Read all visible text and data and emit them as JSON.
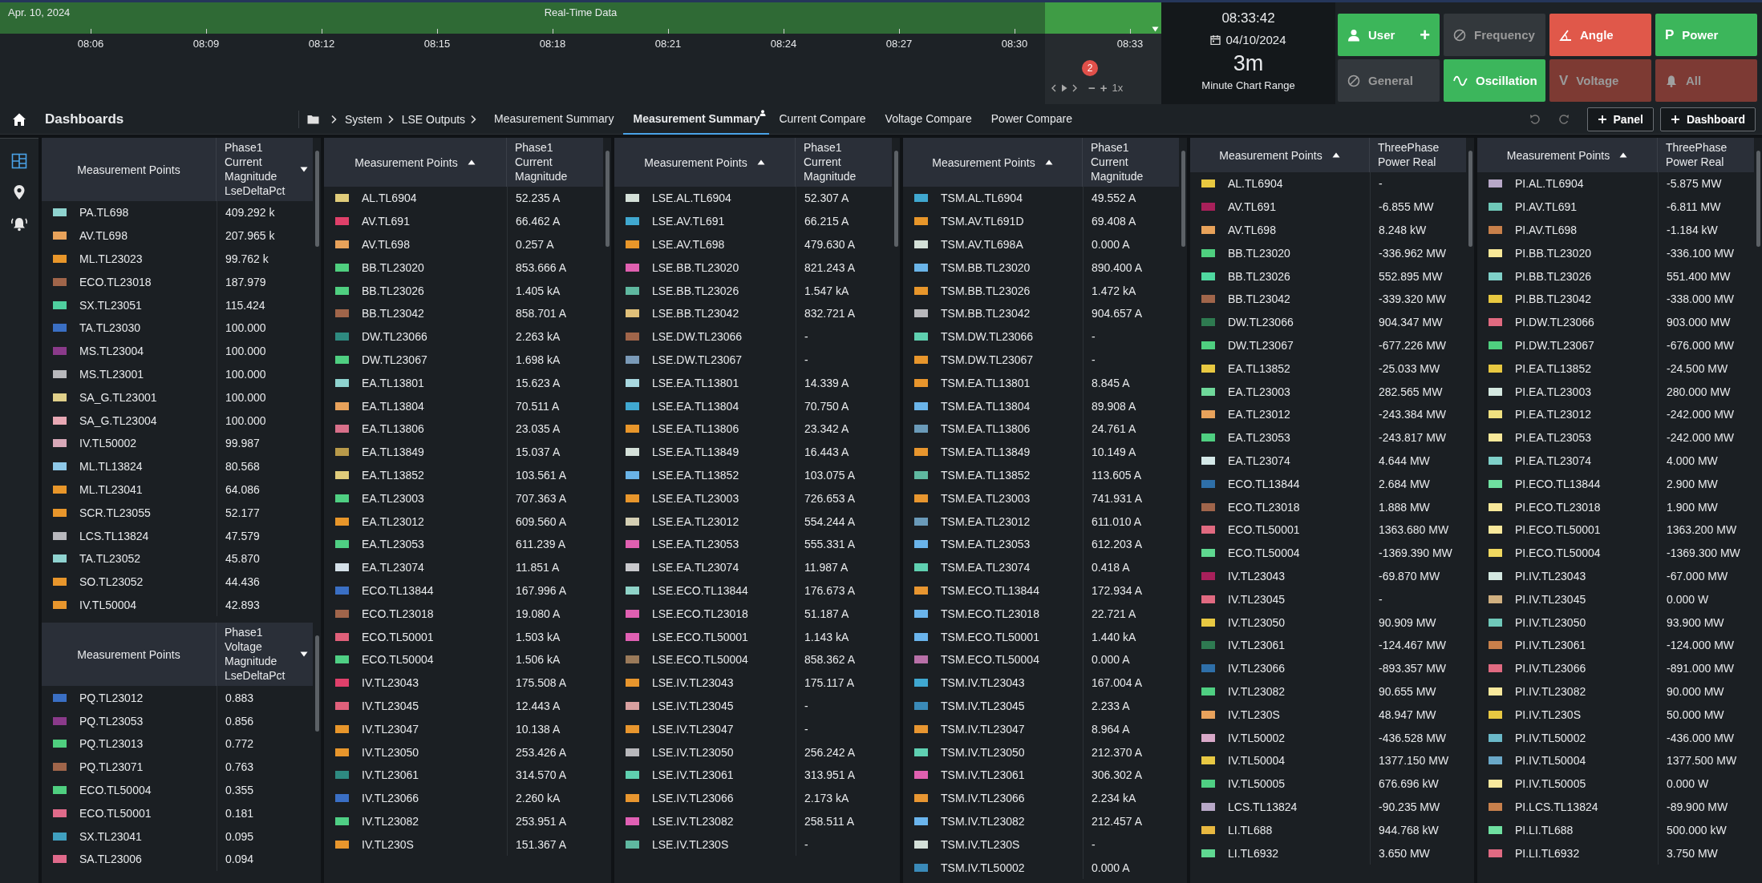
{
  "timeline": {
    "date": "Apr. 10, 2024",
    "title": "Real-Time Data",
    "ticks": [
      "08:06",
      "08:09",
      "08:12",
      "08:15",
      "08:18",
      "08:21",
      "08:24",
      "08:27",
      "08:30",
      "08:33"
    ],
    "alert_count": "2",
    "zoom_out": "−",
    "zoom_in": "+",
    "zoom_level": "1x"
  },
  "clock": {
    "time": "08:33:42",
    "date": "04/10/2024",
    "range": "3m",
    "range_label": "Minute Chart Range"
  },
  "modes": [
    {
      "label": "User",
      "suffix": "+",
      "color": "#3cb65a",
      "on": true
    },
    {
      "label": "Frequency",
      "color": "#33383c",
      "on": false
    },
    {
      "label": "Angle",
      "color": "#e0584a",
      "on": true
    },
    {
      "label": "Power",
      "glyph": "P",
      "color": "#3cb65b",
      "on": true
    },
    {
      "label": "General",
      "color": "#33383d",
      "on": false
    },
    {
      "label": "Oscillation",
      "color": "#3cb65c",
      "on": true
    },
    {
      "label": "Voltage",
      "glyph": "V",
      "color": "#7d3a33",
      "on": false
    },
    {
      "label": "All",
      "color": "#7d3a34",
      "on": false
    }
  ],
  "toolbar": {
    "title": "Dashboards",
    "breadcrumb": [
      "System",
      "LSE Outputs"
    ],
    "tabs": [
      {
        "label": "Measurement Summary",
        "selected": false,
        "shared": false
      },
      {
        "label": "Measurement Summary",
        "selected": true,
        "shared": true
      },
      {
        "label": "Current Compare",
        "selected": false,
        "shared": false
      },
      {
        "label": "Voltage Compare",
        "selected": false,
        "shared": false
      },
      {
        "label": "Power Compare",
        "selected": false,
        "shared": false
      }
    ],
    "actions": [
      "Panel",
      "Dashboard"
    ]
  },
  "sidebar": {
    "items": [
      {
        "selected": true
      },
      {
        "selected": false
      },
      {
        "selected": false
      }
    ]
  },
  "panels": [
    {
      "tables": [
        {
          "columns": [
            {
              "label": "Measurement Points",
              "sort_ascending": false,
              "menu": false
            },
            {
              "label": "Phase1 Current Magnitude LseDeltaPct",
              "sort_ascending": false,
              "menu": true
            }
          ],
          "rows": [
            {
              "name": "PA.TL698",
              "value": "409.292 k",
              "color": "#8fd3cf"
            },
            {
              "name": "AV.TL698",
              "value": "207.965 k",
              "color": "#e8a25a"
            },
            {
              "name": "ML.TL23023",
              "value": "99.762 k",
              "color": "#e8962a"
            },
            {
              "name": "ECO.TL23018",
              "value": "187.979",
              "color": "#a0654a"
            },
            {
              "name": "SX.TL23051",
              "value": "115.424",
              "color": "#4fcf9f"
            },
            {
              "name": "TA.TL23030",
              "value": "100.000",
              "color": "#3a6fc4"
            },
            {
              "name": "MS.TL23004",
              "value": "100.000",
              "color": "#8a3a8a"
            },
            {
              "name": "MS.TL23001",
              "value": "100.000",
              "color": "#b8b8bc"
            },
            {
              "name": "SA_G.TL23001",
              "value": "100.000",
              "color": "#e0d08a"
            },
            {
              "name": "SA_G.TL23004",
              "value": "100.000",
              "color": "#e8a8b4"
            },
            {
              "name": "IV.TL50002",
              "value": "99.987",
              "color": "#d8a8b8"
            },
            {
              "name": "ML.TL13824",
              "value": "80.568",
              "color": "#8ec8e8"
            },
            {
              "name": "ML.TL23041",
              "value": "64.086",
              "color": "#e8962a"
            },
            {
              "name": "SCR.TL23055",
              "value": "52.177",
              "color": "#e8962b"
            },
            {
              "name": "LCS.TL13824",
              "value": "47.579",
              "color": "#b8b8bd"
            },
            {
              "name": "TA.TL23052",
              "value": "45.870",
              "color": "#8fd3d0"
            },
            {
              "name": "SO.TL23052",
              "value": "44.436",
              "color": "#e8962c"
            },
            {
              "name": "IV.TL50004",
              "value": "42.893",
              "color": "#e8962d"
            }
          ]
        },
        {
          "columns": [
            {
              "label": "Measurement Points",
              "sort_ascending": false,
              "menu": false
            },
            {
              "label": "Phase1 Voltage Magnitude LseDeltaPct",
              "sort_ascending": false,
              "menu": true
            }
          ],
          "rows": [
            {
              "name": "PQ.TL23012",
              "value": "0.883",
              "color": "#3a6fc4"
            },
            {
              "name": "PQ.TL23053",
              "value": "0.856",
              "color": "#8a3a8a"
            },
            {
              "name": "PQ.TL23013",
              "value": "0.772",
              "color": "#4fcf7f"
            },
            {
              "name": "PQ.TL23071",
              "value": "0.763",
              "color": "#a0654a"
            },
            {
              "name": "ECO.TL50004",
              "value": "0.355",
              "color": "#4fcf80"
            },
            {
              "name": "ECO.TL50001",
              "value": "0.181",
              "color": "#e06a8a"
            },
            {
              "name": "SX.TL23041",
              "value": "0.095",
              "color": "#40a0c0"
            },
            {
              "name": "SA.TL23006",
              "value": "0.094",
              "color": "#e06a8b"
            }
          ]
        }
      ]
    },
    {
      "tables": [
        {
          "columns": [
            {
              "label": "Measurement Points",
              "sort_ascending": true,
              "menu": false
            },
            {
              "label": "Phase1 Current Magnitude",
              "sort_ascending": false,
              "menu": false
            }
          ],
          "rows": [
            {
              "name": "AL.TL6904",
              "value": "52.235 A",
              "color": "#e0cc7a"
            },
            {
              "name": "AV.TL691",
              "value": "66.462 A",
              "color": "#e0406a"
            },
            {
              "name": "AV.TL698",
              "value": "0.257 A",
              "color": "#e8a25a"
            },
            {
              "name": "BB.TL23020",
              "value": "853.666 A",
              "color": "#4fcf7f"
            },
            {
              "name": "BB.TL23026",
              "value": "1.405 kA",
              "color": "#4fcf80"
            },
            {
              "name": "BB.TL23042",
              "value": "858.701 A",
              "color": "#a0654a"
            },
            {
              "name": "DW.TL23066",
              "value": "2.263 kA",
              "color": "#2e8a80"
            },
            {
              "name": "DW.TL23067",
              "value": "1.698 kA",
              "color": "#4fcf81"
            },
            {
              "name": "EA.TL13801",
              "value": "15.623 A",
              "color": "#8fd3cf"
            },
            {
              "name": "EA.TL13804",
              "value": "70.511 A",
              "color": "#e8a25b"
            },
            {
              "name": "EA.TL13806",
              "value": "23.035 A",
              "color": "#d8708a"
            },
            {
              "name": "EA.TL13849",
              "value": "15.037 A",
              "color": "#b89a4a"
            },
            {
              "name": "EA.TL13852",
              "value": "103.561 A",
              "color": "#e0cc7b"
            },
            {
              "name": "EA.TL23003",
              "value": "707.363 A",
              "color": "#4fcf82"
            },
            {
              "name": "EA.TL23012",
              "value": "609.560 A",
              "color": "#e8962a"
            },
            {
              "name": "EA.TL23053",
              "value": "611.239 A",
              "color": "#4fcf83"
            },
            {
              "name": "EA.TL23074",
              "value": "11.851 A",
              "color": "#d4e0e8"
            },
            {
              "name": "ECO.TL13844",
              "value": "167.996 A",
              "color": "#3a6fc4"
            },
            {
              "name": "ECO.TL23018",
              "value": "19.080 A",
              "color": "#a0654b"
            },
            {
              "name": "ECO.TL50001",
              "value": "1.503 kA",
              "color": "#e0607a"
            },
            {
              "name": "ECO.TL50004",
              "value": "1.506 kA",
              "color": "#4fcf84"
            },
            {
              "name": "IV.TL23043",
              "value": "175.508 A",
              "color": "#e0406b"
            },
            {
              "name": "IV.TL23045",
              "value": "12.443 A",
              "color": "#e0607b"
            },
            {
              "name": "IV.TL23047",
              "value": "10.138 A",
              "color": "#e8962b"
            },
            {
              "name": "IV.TL23050",
              "value": "253.426 A",
              "color": "#e8962c"
            },
            {
              "name": "IV.TL23061",
              "value": "314.570 A",
              "color": "#2e8a81"
            },
            {
              "name": "IV.TL23066",
              "value": "2.260 kA",
              "color": "#3a6fc5"
            },
            {
              "name": "IV.TL23082",
              "value": "253.951 A",
              "color": "#4fcf85"
            },
            {
              "name": "IV.TL230S",
              "value": "151.367 A",
              "color": "#e8962d"
            }
          ]
        }
      ]
    },
    {
      "tables": [
        {
          "columns": [
            {
              "label": "Measurement Points",
              "sort_ascending": true,
              "menu": false
            },
            {
              "label": "Phase1 Current Magnitude",
              "sort_ascending": false,
              "menu": false
            }
          ],
          "rows": [
            {
              "name": "LSE.AL.TL6904",
              "value": "52.307 A",
              "color": "#d4e0d8"
            },
            {
              "name": "LSE.AV.TL691",
              "value": "66.215 A",
              "color": "#40a8d0"
            },
            {
              "name": "LSE.AV.TL698",
              "value": "479.630 A",
              "color": "#e8962a"
            },
            {
              "name": "LSE.BB.TL23020",
              "value": "821.243 A",
              "color": "#e060b0"
            },
            {
              "name": "LSE.BB.TL23026",
              "value": "1.547 kA",
              "color": "#5fb8a0"
            },
            {
              "name": "LSE.BB.TL23042",
              "value": "832.721 A",
              "color": "#e0c07a"
            },
            {
              "name": "LSE.DW.TL23066",
              "value": "-",
              "color": "#a0654a"
            },
            {
              "name": "LSE.DW.TL23067",
              "value": "-",
              "color": "#7a9ab8"
            },
            {
              "name": "LSE.EA.TL13801",
              "value": "14.339 A",
              "color": "#a8d8e0"
            },
            {
              "name": "LSE.EA.TL13804",
              "value": "70.750 A",
              "color": "#40a8d1"
            },
            {
              "name": "LSE.EA.TL13806",
              "value": "23.342 A",
              "color": "#e8962b"
            },
            {
              "name": "LSE.EA.TL13849",
              "value": "16.443 A",
              "color": "#d4e0d9"
            },
            {
              "name": "LSE.EA.TL13852",
              "value": "103.075 A",
              "color": "#6ab4e8"
            },
            {
              "name": "LSE.EA.TL23003",
              "value": "726.653 A",
              "color": "#e8962c"
            },
            {
              "name": "LSE.EA.TL23012",
              "value": "554.244 A",
              "color": "#d4cfb4"
            },
            {
              "name": "LSE.EA.TL23053",
              "value": "555.331 A",
              "color": "#e060b1"
            },
            {
              "name": "LSE.EA.TL23074",
              "value": "11.987 A",
              "color": "#c8c8cc"
            },
            {
              "name": "LSE.ECO.TL13844",
              "value": "176.673 A",
              "color": "#8fd3c8"
            },
            {
              "name": "LSE.ECO.TL23018",
              "value": "51.187 A",
              "color": "#e060b2"
            },
            {
              "name": "LSE.ECO.TL50001",
              "value": "1.143 kA",
              "color": "#e060b3"
            },
            {
              "name": "LSE.ECO.TL50004",
              "value": "858.362 A",
              "color": "#9a7a5a"
            },
            {
              "name": "LSE.IV.TL23043",
              "value": "175.117 A",
              "color": "#e8962d"
            },
            {
              "name": "LSE.IV.TL23045",
              "value": "-",
              "color": "#d8a0a0"
            },
            {
              "name": "LSE.IV.TL23047",
              "value": "-",
              "color": "#e8962e"
            },
            {
              "name": "LSE.IV.TL23050",
              "value": "256.242 A",
              "color": "#b8b8bc"
            },
            {
              "name": "LSE.IV.TL23061",
              "value": "313.951 A",
              "color": "#5fd0b0"
            },
            {
              "name": "LSE.IV.TL23066",
              "value": "2.173 kA",
              "color": "#e8962f"
            },
            {
              "name": "LSE.IV.TL23082",
              "value": "258.511 A",
              "color": "#e060b4"
            },
            {
              "name": "LSE.IV.TL230S",
              "value": "-",
              "color": "#5fb8a1"
            }
          ]
        }
      ]
    },
    {
      "tables": [
        {
          "columns": [
            {
              "label": "Measurement Points",
              "sort_ascending": true,
              "menu": false
            },
            {
              "label": "Phase1 Current Magnitude",
              "sort_ascending": false,
              "menu": false
            }
          ],
          "rows": [
            {
              "name": "TSM.AL.TL6904",
              "value": "49.552 A",
              "color": "#40a8d0"
            },
            {
              "name": "TSM.AV.TL691D",
              "value": "69.408 A",
              "color": "#e8962a"
            },
            {
              "name": "TSM.AV.TL698A",
              "value": "0.000 A",
              "color": "#d4e0d8"
            },
            {
              "name": "TSM.BB.TL23020",
              "value": "890.400 A",
              "color": "#6ab4e8"
            },
            {
              "name": "TSM.BB.TL23026",
              "value": "1.472 kA",
              "color": "#e8962b"
            },
            {
              "name": "TSM.BB.TL23042",
              "value": "904.657 A",
              "color": "#b8b8bc"
            },
            {
              "name": "TSM.DW.TL23066",
              "value": "-",
              "color": "#5fd0b0"
            },
            {
              "name": "TSM.DW.TL23067",
              "value": "-",
              "color": "#e8962c"
            },
            {
              "name": "TSM.EA.TL13801",
              "value": "8.845 A",
              "color": "#e8962d"
            },
            {
              "name": "TSM.EA.TL13804",
              "value": "89.908 A",
              "color": "#6ab4e9"
            },
            {
              "name": "TSM.EA.TL13806",
              "value": "24.761 A",
              "color": "#6a9ab8"
            },
            {
              "name": "TSM.EA.TL13849",
              "value": "10.149 A",
              "color": "#e8962e"
            },
            {
              "name": "TSM.EA.TL13852",
              "value": "113.605 A",
              "color": "#5fb8a0"
            },
            {
              "name": "TSM.EA.TL23003",
              "value": "741.931 A",
              "color": "#e8962f"
            },
            {
              "name": "TSM.EA.TL23012",
              "value": "611.010 A",
              "color": "#6a9ab9"
            },
            {
              "name": "TSM.EA.TL23053",
              "value": "612.203 A",
              "color": "#6ab4ea"
            },
            {
              "name": "TSM.EA.TL23074",
              "value": "0.418 A",
              "color": "#5fd0b1"
            },
            {
              "name": "TSM.ECO.TL13844",
              "value": "172.934 A",
              "color": "#e89630"
            },
            {
              "name": "TSM.ECO.TL23018",
              "value": "22.721 A",
              "color": "#6ab4eb"
            },
            {
              "name": "TSM.ECO.TL50001",
              "value": "1.440 kA",
              "color": "#6ab4ec"
            },
            {
              "name": "TSM.ECO.TL50004",
              "value": "0.000 A",
              "color": "#b870a8"
            },
            {
              "name": "TSM.IV.TL23043",
              "value": "167.004 A",
              "color": "#40a8d1"
            },
            {
              "name": "TSM.IV.TL23045",
              "value": "2.233 A",
              "color": "#3a8ab8"
            },
            {
              "name": "TSM.IV.TL23047",
              "value": "8.964 A",
              "color": "#e89631"
            },
            {
              "name": "TSM.IV.TL23050",
              "value": "212.370 A",
              "color": "#5fd0b2"
            },
            {
              "name": "TSM.IV.TL23061",
              "value": "306.302 A",
              "color": "#e060b0"
            },
            {
              "name": "TSM.IV.TL23066",
              "value": "2.234 kA",
              "color": "#e89632"
            },
            {
              "name": "TSM.IV.TL23082",
              "value": "212.457 A",
              "color": "#6ab4ed"
            },
            {
              "name": "TSM.IV.TL230S",
              "value": "-",
              "color": "#d4e0d9"
            },
            {
              "name": "TSM.IV.TL50002",
              "value": "0.000 A",
              "color": "#3a8ab9"
            }
          ]
        }
      ]
    },
    {
      "tables": [
        {
          "columns": [
            {
              "label": "Measurement Points",
              "sort_ascending": true,
              "menu": false
            },
            {
              "label": "ThreePhase Power Real",
              "sort_ascending": false,
              "menu": false
            }
          ],
          "rows": [
            {
              "name": "AL.TL6904",
              "value": "-",
              "color": "#e8c840"
            },
            {
              "name": "AV.TL691",
              "value": "-6.855 MW",
              "color": "#a8205a"
            },
            {
              "name": "AV.TL698",
              "value": "8.248 kW",
              "color": "#e8a25a"
            },
            {
              "name": "BB.TL23020",
              "value": "-336.962 MW",
              "color": "#4fcf7f"
            },
            {
              "name": "BB.TL23026",
              "value": "552.895 MW",
              "color": "#4fd8a0"
            },
            {
              "name": "BB.TL23042",
              "value": "-339.320 MW",
              "color": "#a0654a"
            },
            {
              "name": "DW.TL23066",
              "value": "904.347 MW",
              "color": "#2e7a50"
            },
            {
              "name": "DW.TL23067",
              "value": "-677.226 MW",
              "color": "#4fcf80"
            },
            {
              "name": "EA.TL13852",
              "value": "-25.033 MW",
              "color": "#e8c841"
            },
            {
              "name": "EA.TL23003",
              "value": "282.565 MW",
              "color": "#6fd89a"
            },
            {
              "name": "EA.TL23012",
              "value": "-243.384 MW",
              "color": "#e8a25b"
            },
            {
              "name": "EA.TL23053",
              "value": "-243.817 MW",
              "color": "#4fcf81"
            },
            {
              "name": "EA.TL23074",
              "value": "4.644 MW",
              "color": "#d4e8e8"
            },
            {
              "name": "ECO.TL13844",
              "value": "2.684 MW",
              "color": "#2e6fa8"
            },
            {
              "name": "ECO.TL23018",
              "value": "1.888 MW",
              "color": "#a0654b"
            },
            {
              "name": "ECO.TL50001",
              "value": "1363.680 MW",
              "color": "#e06a80"
            },
            {
              "name": "ECO.TL50004",
              "value": "-1369.390 MW",
              "color": "#5fd890"
            },
            {
              "name": "IV.TL23043",
              "value": "-69.870 MW",
              "color": "#a8205b"
            },
            {
              "name": "IV.TL23045",
              "value": "-",
              "color": "#e06a81"
            },
            {
              "name": "IV.TL23050",
              "value": "90.909 MW",
              "color": "#e8c842"
            },
            {
              "name": "IV.TL23061",
              "value": "-124.467 MW",
              "color": "#2e7a51"
            },
            {
              "name": "IV.TL23066",
              "value": "-893.357 MW",
              "color": "#2e6fa9"
            },
            {
              "name": "IV.TL23082",
              "value": "90.655 MW",
              "color": "#4fcf82"
            },
            {
              "name": "IV.TL230S",
              "value": "48.947 MW",
              "color": "#e8a25c"
            },
            {
              "name": "IV.TL50002",
              "value": "-436.528 MW",
              "color": "#d8a8c8"
            },
            {
              "name": "IV.TL50004",
              "value": "1377.150 MW",
              "color": "#e8c843"
            },
            {
              "name": "IV.TL50005",
              "value": "676.696 kW",
              "color": "#4fcf83"
            },
            {
              "name": "LCS.TL13824",
              "value": "-90.235 MW",
              "color": "#b8a8c8"
            },
            {
              "name": "LI.TL688",
              "value": "944.768 kW",
              "color": "#e8b840"
            },
            {
              "name": "LI.TL6932",
              "value": "3.650 MW",
              "color": "#5fd891"
            }
          ]
        }
      ]
    },
    {
      "tables": [
        {
          "columns": [
            {
              "label": "Measurement Points",
              "sort_ascending": true,
              "menu": false
            },
            {
              "label": "ThreePhase Power Real",
              "sort_ascending": false,
              "menu": false
            }
          ],
          "rows": [
            {
              "name": "PI.AL.TL6904",
              "value": "-5.875 MW",
              "color": "#b8a8c8"
            },
            {
              "name": "PI.AV.TL691",
              "value": "-6.811 MW",
              "color": "#6fc8b8"
            },
            {
              "name": "PI.AV.TL698",
              "value": "-1.184 kW",
              "color": "#c8804a"
            },
            {
              "name": "PI.BB.TL23020",
              "value": "-336.100 MW",
              "color": "#f8e898"
            },
            {
              "name": "PI.BB.TL23026",
              "value": "551.400 MW",
              "color": "#7fd0c8"
            },
            {
              "name": "PI.BB.TL23042",
              "value": "-338.000 MW",
              "color": "#e8c840"
            },
            {
              "name": "PI.DW.TL23066",
              "value": "903.000 MW",
              "color": "#e06a80"
            },
            {
              "name": "PI.DW.TL23067",
              "value": "-676.000 MW",
              "color": "#4fcf7f"
            },
            {
              "name": "PI.EA.TL13852",
              "value": "-24.500 MW",
              "color": "#e8c841"
            },
            {
              "name": "PI.EA.TL23003",
              "value": "280.000 MW",
              "color": "#d4e8e0"
            },
            {
              "name": "PI.EA.TL23012",
              "value": "-242.000 MW",
              "color": "#f0e080"
            },
            {
              "name": "PI.EA.TL23053",
              "value": "-242.000 MW",
              "color": "#f8e899"
            },
            {
              "name": "PI.EA.TL23074",
              "value": "4.000 MW",
              "color": "#7fd0c9"
            },
            {
              "name": "PI.ECO.TL13844",
              "value": "2.900 MW",
              "color": "#6fe0a0"
            },
            {
              "name": "PI.ECO.TL23018",
              "value": "1.900 MW",
              "color": "#f8e89a"
            },
            {
              "name": "PI.ECO.TL50001",
              "value": "1363.200 MW",
              "color": "#f8e89b"
            },
            {
              "name": "PI.ECO.TL50004",
              "value": "-1369.300 MW",
              "color": "#f0d860"
            },
            {
              "name": "PI.IV.TL23043",
              "value": "-67.000 MW",
              "color": "#d4e8e1"
            },
            {
              "name": "PI.IV.TL23045",
              "value": "0.000 W",
              "color": "#d0b080"
            },
            {
              "name": "PI.IV.TL23050",
              "value": "93.900 MW",
              "color": "#6fc8b9"
            },
            {
              "name": "PI.IV.TL23061",
              "value": "-124.000 MW",
              "color": "#c8804b"
            },
            {
              "name": "PI.IV.TL23066",
              "value": "-891.000 MW",
              "color": "#e06a81"
            },
            {
              "name": "PI.IV.TL23082",
              "value": "90.000 MW",
              "color": "#f8e89c"
            },
            {
              "name": "PI.IV.TL230S",
              "value": "50.000 MW",
              "color": "#e8c842"
            },
            {
              "name": "PI.IV.TL50002",
              "value": "-436.000 MW",
              "color": "#6ab8c8"
            },
            {
              "name": "PI.IV.TL50004",
              "value": "1377.500 MW",
              "color": "#6aa8c8"
            },
            {
              "name": "PI.IV.TL50005",
              "value": "0.000 W",
              "color": "#f8e89d"
            },
            {
              "name": "PI.LCS.TL13824",
              "value": "-89.900 MW",
              "color": "#c8804c"
            },
            {
              "name": "PI.LI.TL688",
              "value": "500.000 kW",
              "color": "#6fe0a1"
            },
            {
              "name": "PI.LI.TL6932",
              "value": "3.750 MW",
              "color": "#e06a82"
            }
          ]
        }
      ]
    }
  ]
}
